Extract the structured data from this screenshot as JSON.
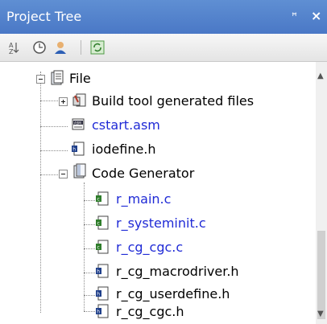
{
  "window": {
    "title": "Project Tree",
    "pin_glyph": "ᵖ",
    "close_glyph": "×"
  },
  "toolbar": {
    "icons": [
      "sort-icon",
      "clock-icon",
      "person-icon",
      "refresh-icon"
    ]
  },
  "tree": {
    "file": "File",
    "build": "Build tool generated files",
    "cstart": "cstart.asm",
    "iodefine": "iodefine.h",
    "code_generator": "Code Generator",
    "r_main": "r_main.c",
    "r_systeminit": "r_systeminit.c",
    "r_cg_cgc_c": "r_cg_cgc.c",
    "r_cg_macrodriver": "r_cg_macrodriver.h",
    "r_cg_userdefine": "r_cg_userdefine.h",
    "r_cg_cgc_h": "r_cg_cgc.h"
  },
  "colors": {
    "title_bar": "#4a78c6",
    "link_blue": "#1f2ad6"
  }
}
